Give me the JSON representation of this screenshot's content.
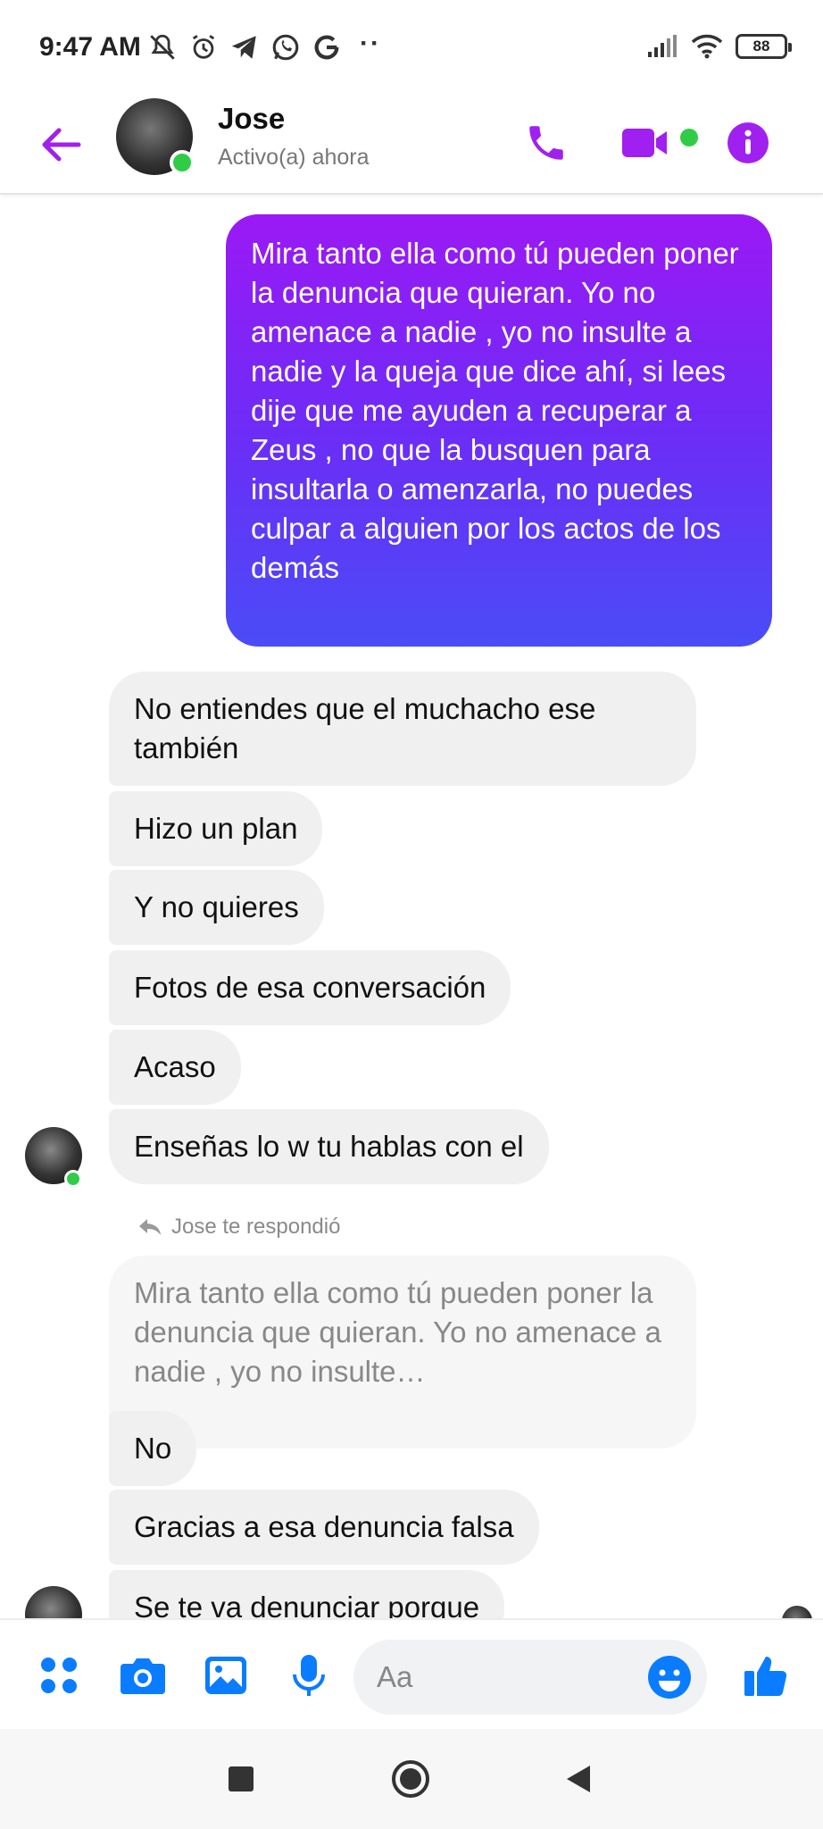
{
  "status_bar": {
    "time": "9:47 AM",
    "left_icons": [
      "muted-bell-icon",
      "alarm-icon",
      "telegram-icon",
      "whatsapp-icon",
      "google-icon"
    ],
    "more": "··",
    "battery": "88"
  },
  "header": {
    "contact_name": "Jose",
    "contact_status": "Activo(a) ahora",
    "accent_color": "#a020f0",
    "online_color": "#31cc46"
  },
  "messages": {
    "outgoing": "Mira tanto ella como tú pueden poner la denuncia que quieran. Yo no amenace a nadie , yo no insulte a nadie y la queja que dice ahí, si lees dije que me ayuden a recuperar a Zeus , no que la busquen para insultarla o amenzarla, no puedes culpar a alguien por los actos de los demás",
    "incoming_1": "No entiendes que el muchacho ese también",
    "incoming_2": "Hizo un plan",
    "incoming_3": "Y no quieres",
    "incoming_4": "Fotos de esa conversación",
    "incoming_5": "Acaso",
    "incoming_6": "Enseñas lo w tu hablas con el",
    "reply_label": "Jose te respondió",
    "quoted": "Mira tanto ella como tú pueden poner la denuncia que quieran. Yo no amenace a nadie , yo no insulte…",
    "incoming_7": "No",
    "incoming_8": "Gracias a esa denuncia falsa",
    "incoming_9": "Se te va denunciar porque"
  },
  "composer": {
    "placeholder": "Aa",
    "accent_color": "#0a7cff"
  }
}
